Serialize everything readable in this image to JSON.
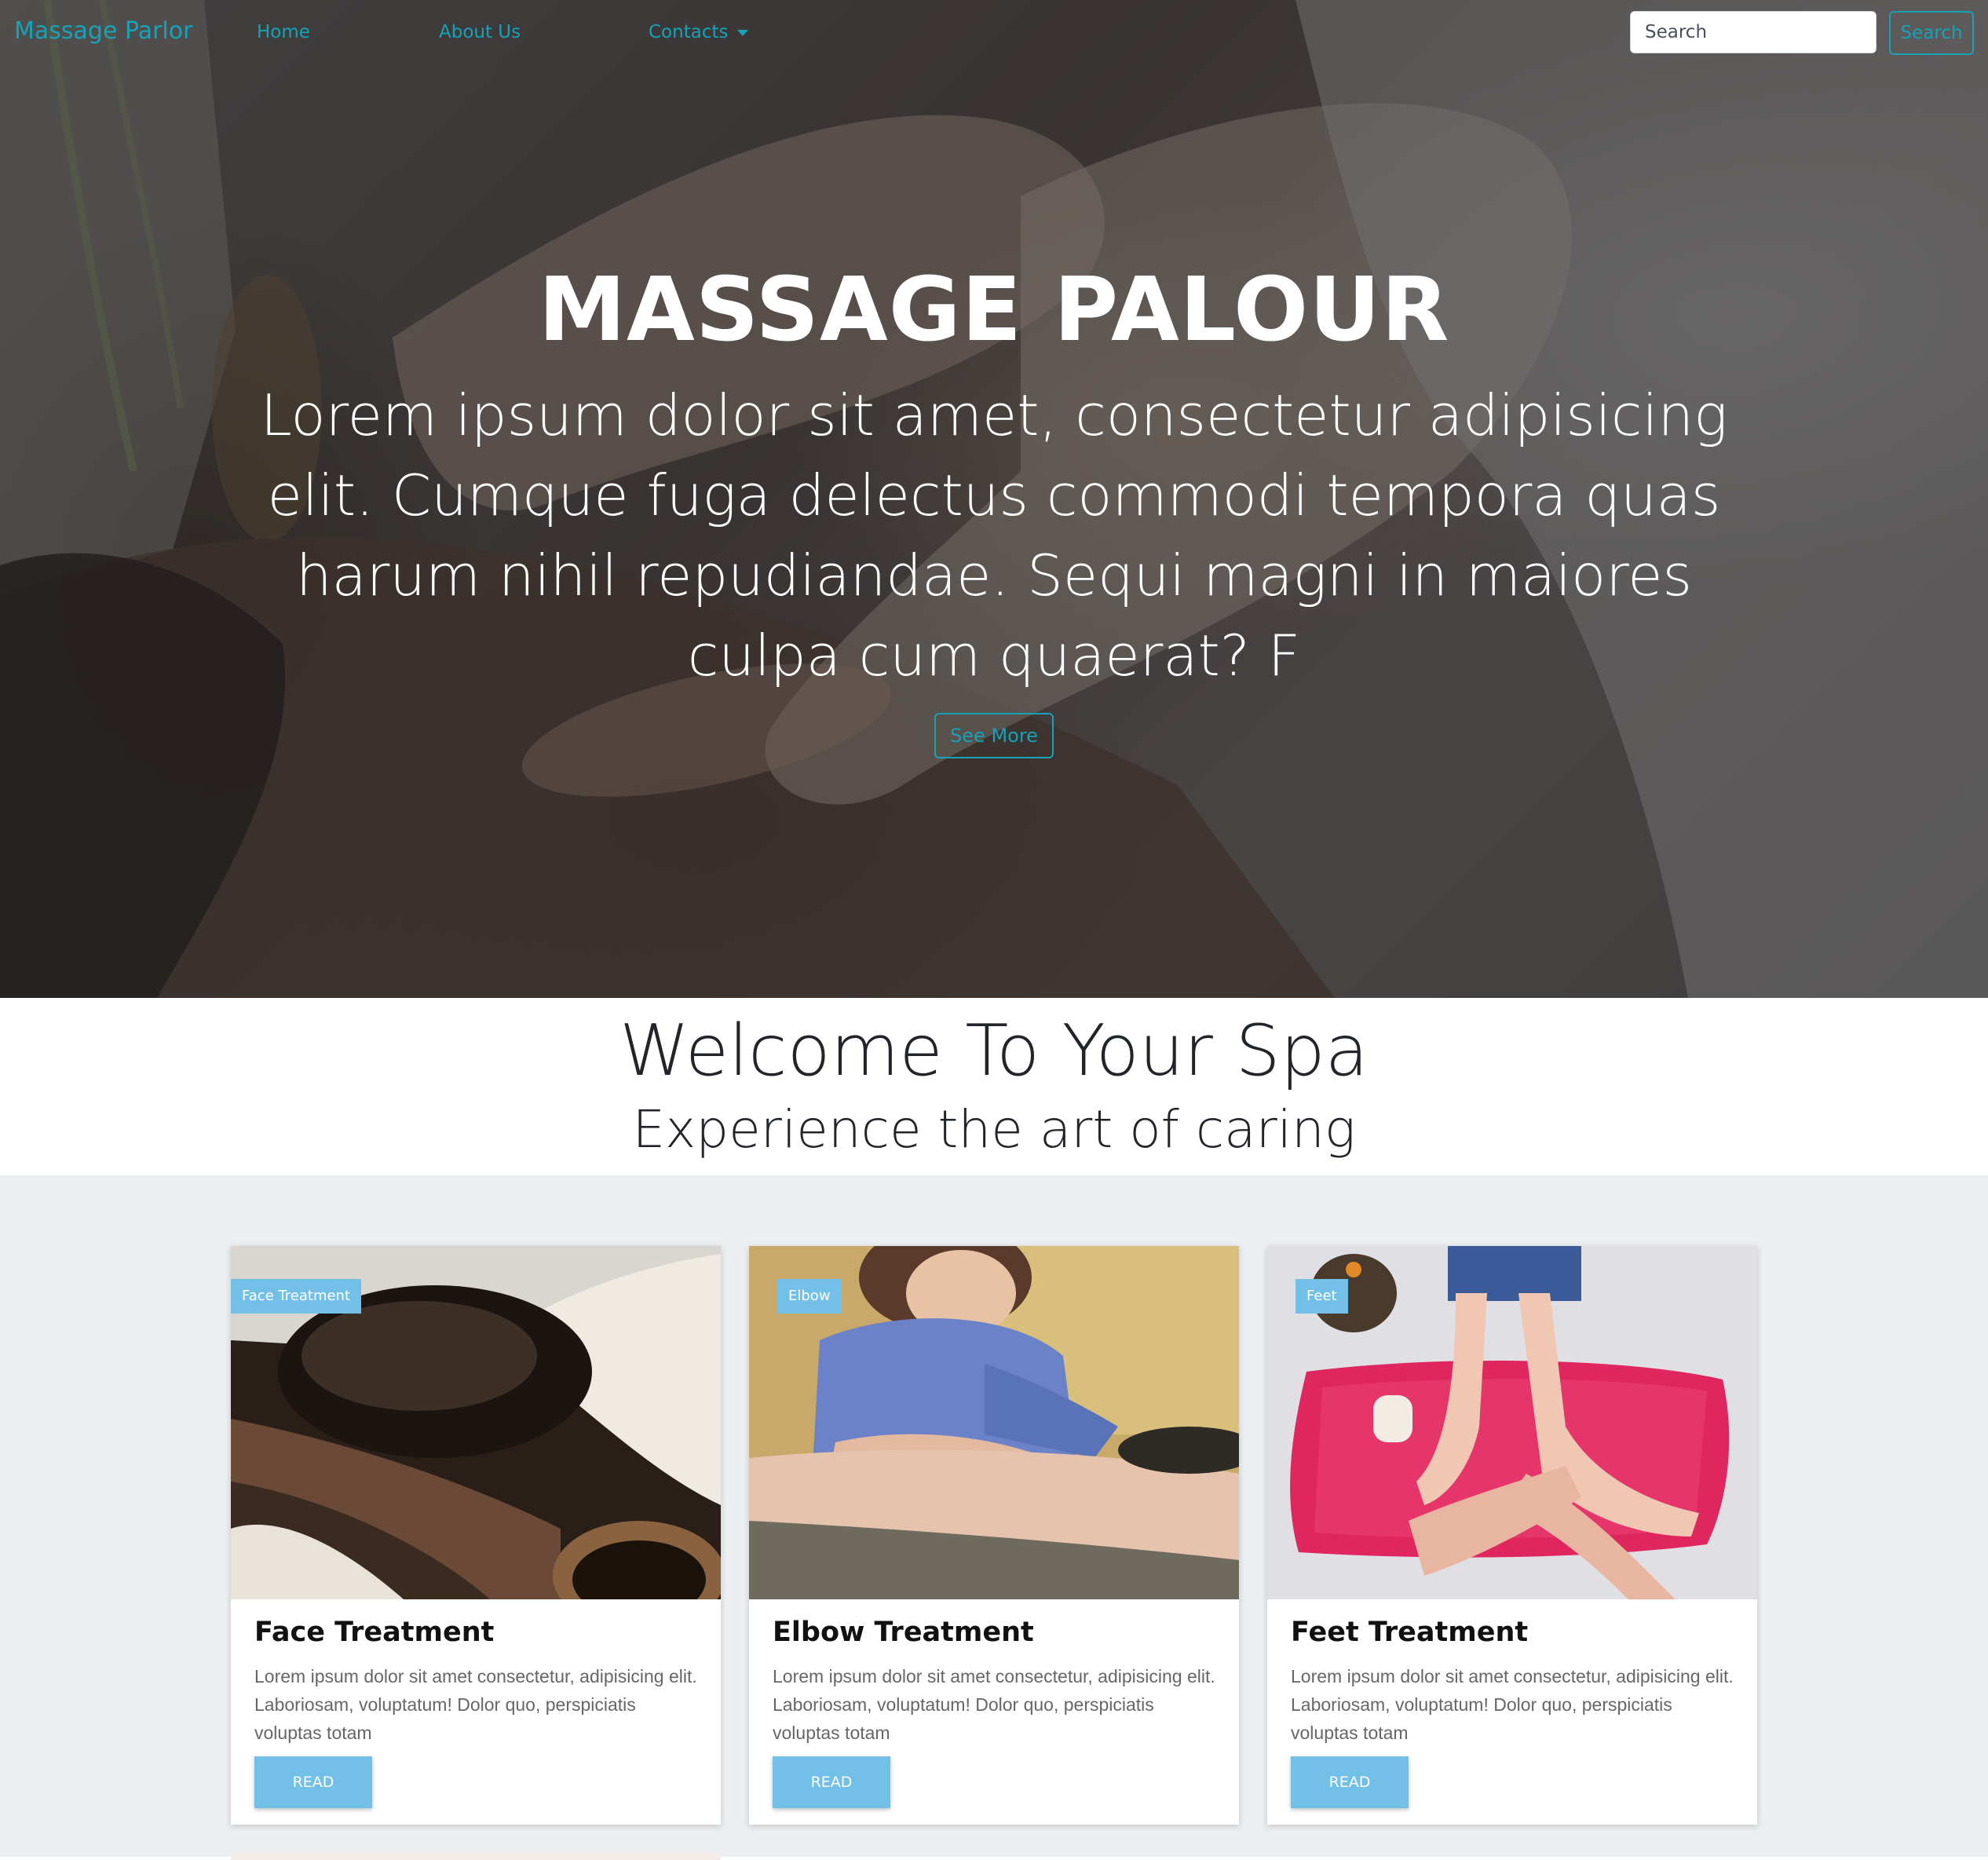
{
  "navbar": {
    "brand": "Massage Parlor",
    "links": [
      {
        "label": "Home"
      },
      {
        "label": "About Us"
      },
      {
        "label": "Contacts",
        "has_dropdown": true
      }
    ],
    "search": {
      "placeholder": "Search",
      "button_label": "Search"
    }
  },
  "hero": {
    "title": "MASSAGE PALOUR",
    "text": "Lorem ipsum dolor sit amet, consectetur adipisicing elit. Cumque fuga delectus commodi tempora quas harum nihil repudiandae. Sequi magni in maiores culpa cum quaerat? F",
    "button_label": "See More"
  },
  "welcome": {
    "title": "Welcome To Your Spa",
    "subtitle": "Experience the art of caring"
  },
  "cards": [
    {
      "tag": "Face Treatment",
      "title": "Face Treatment",
      "text": "Lorem ipsum dolor sit amet consectetur, adipisicing elit. Laboriosam, voluptatum! Dolor quo, perspiciatis voluptas totam",
      "button_label": "READ"
    },
    {
      "tag": "Elbow",
      "title": "Elbow Treatment",
      "text": "Lorem ipsum dolor sit amet consectetur, adipisicing elit. Laboriosam, voluptatum! Dolor quo, perspiciatis voluptas totam",
      "button_label": "READ"
    },
    {
      "tag": "Feet",
      "title": "Feet Treatment",
      "text": "Lorem ipsum dolor sit amet consectetur, adipisicing elit. Laboriosam, voluptatum! Dolor quo, perspiciatis voluptas totam",
      "button_label": "READ"
    }
  ],
  "colors": {
    "accent": "#17a2b8",
    "card_button": "#72bfe8",
    "section_bg": "#eceff1"
  },
  "icons": {
    "dropdown": "caret-down-icon"
  }
}
